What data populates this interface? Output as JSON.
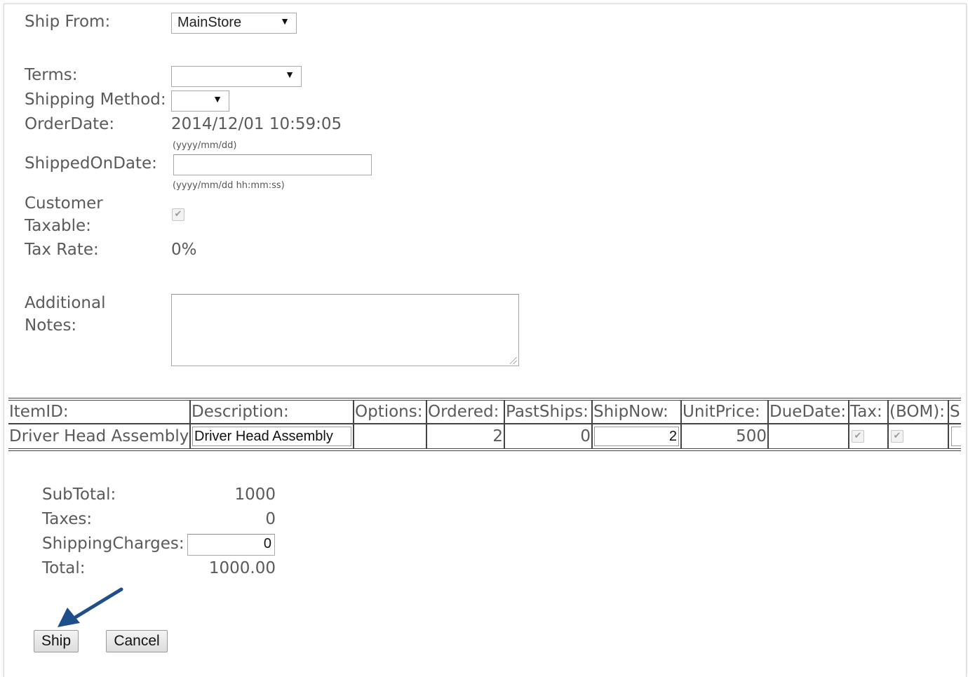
{
  "form": {
    "ship_from": {
      "label": "Ship From:",
      "value": "MainStore"
    },
    "terms": {
      "label": "Terms:",
      "value": ""
    },
    "shipping_method": {
      "label": "Shipping Method:",
      "value": ""
    },
    "order_date": {
      "label": "OrderDate:",
      "value": "2014/12/01 10:59:05",
      "hint": "(yyyy/mm/dd)"
    },
    "shipped_on_date": {
      "label": "ShippedOnDate:",
      "value": "",
      "hint": "(yyyy/mm/dd hh:mm:ss)"
    },
    "customer_taxable": {
      "label_line1": "Customer",
      "label_line2": "Taxable:",
      "checked": true
    },
    "tax_rate": {
      "label": "Tax Rate:",
      "value": "0%"
    },
    "additional_notes": {
      "label_line1": "Additional",
      "label_line2": "Notes:",
      "value": ""
    },
    "arrow_icon": "select-arrow-down-icon"
  },
  "items_table": {
    "headers": [
      "ItemID:",
      "Description:",
      "Options:",
      "Ordered:",
      "PastShips:",
      "ShipNow:",
      "UnitPrice:",
      "DueDate:",
      "Tax:",
      "(BOM):",
      "S"
    ],
    "rows": [
      {
        "item_id": "Driver Head Assembly",
        "description": "Driver Head Assembly",
        "options": "",
        "ordered": "2",
        "past_ships": "0",
        "ship_now": "2",
        "unit_price": "500",
        "due_date": "",
        "tax": true,
        "bom": true
      }
    ]
  },
  "totals": {
    "subtotal": {
      "label": "SubTotal:",
      "value": "1000"
    },
    "taxes": {
      "label": "Taxes:",
      "value": "0"
    },
    "shipping_charges": {
      "label": "ShippingCharges:",
      "value": "0"
    },
    "total": {
      "label": "Total:",
      "value": "1000.00"
    }
  },
  "buttons": {
    "ship": "Ship",
    "cancel": "Cancel"
  },
  "colors": {
    "annotation_arrow": "#1f4e8c",
    "table_border": "#444444",
    "label_text": "#5a5a5a"
  }
}
